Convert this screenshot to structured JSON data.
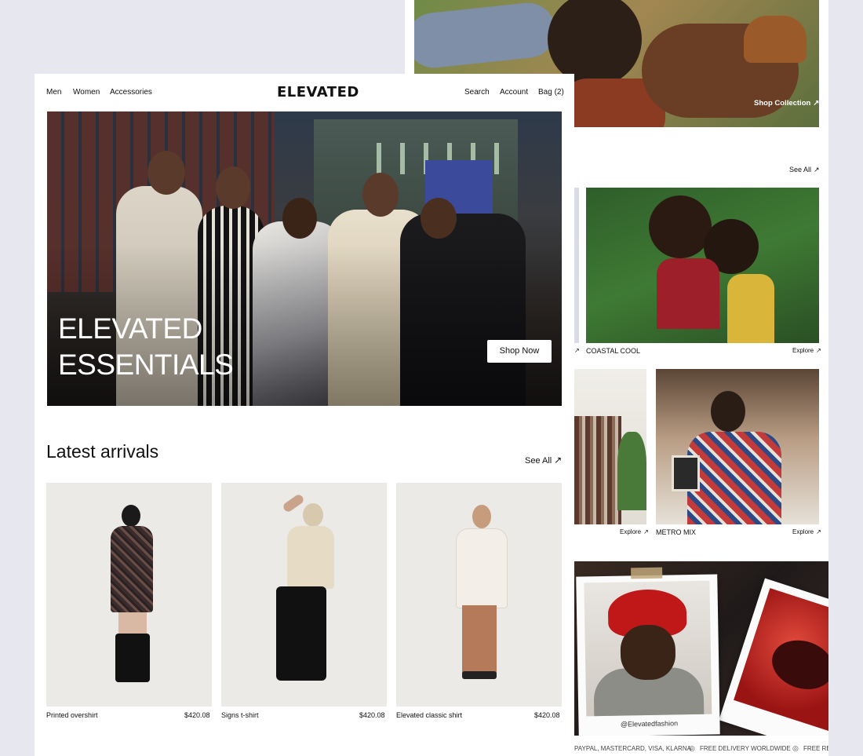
{
  "nav": {
    "left": [
      "Men",
      "Women",
      "Accessories"
    ],
    "brand": "ELEVATED",
    "search": "Search",
    "account": "Account",
    "bag": "Bag (2)"
  },
  "hero": {
    "title_line1": "ELEVATED",
    "title_line2": "ESSENTIALS",
    "cta": "Shop Now"
  },
  "latest": {
    "heading": "Latest arrivals",
    "see_all": "See All",
    "products": [
      {
        "name": "Printed overshirt",
        "price": "$420.08"
      },
      {
        "name": "Signs t-shirt",
        "price": "$420.08"
      },
      {
        "name": "Elevated classic shirt",
        "price": "$420.08"
      }
    ]
  },
  "back": {
    "shop_collection": "Shop Collection",
    "see_all": "See All",
    "collections": [
      {
        "name": "COASTAL COOL",
        "link": "Explore"
      },
      {
        "name": "METRO MIX",
        "link": "Explore"
      }
    ],
    "partial_explore": "Explore",
    "handle": "@Elevatedfashion",
    "footer": {
      "payments": "PAYPAL, MASTERCARD, VISA, KLARNA",
      "delivery": "FREE DELIVERY WORLDWIDE",
      "returns_partial": "FREE RE"
    }
  },
  "colors": {
    "background": "#e6e7ef",
    "surface": "#ffffff",
    "text": "#111111",
    "button_bg": "#ffffff"
  },
  "icons": [
    "arrow-up-right-icon",
    "globe-icon"
  ]
}
